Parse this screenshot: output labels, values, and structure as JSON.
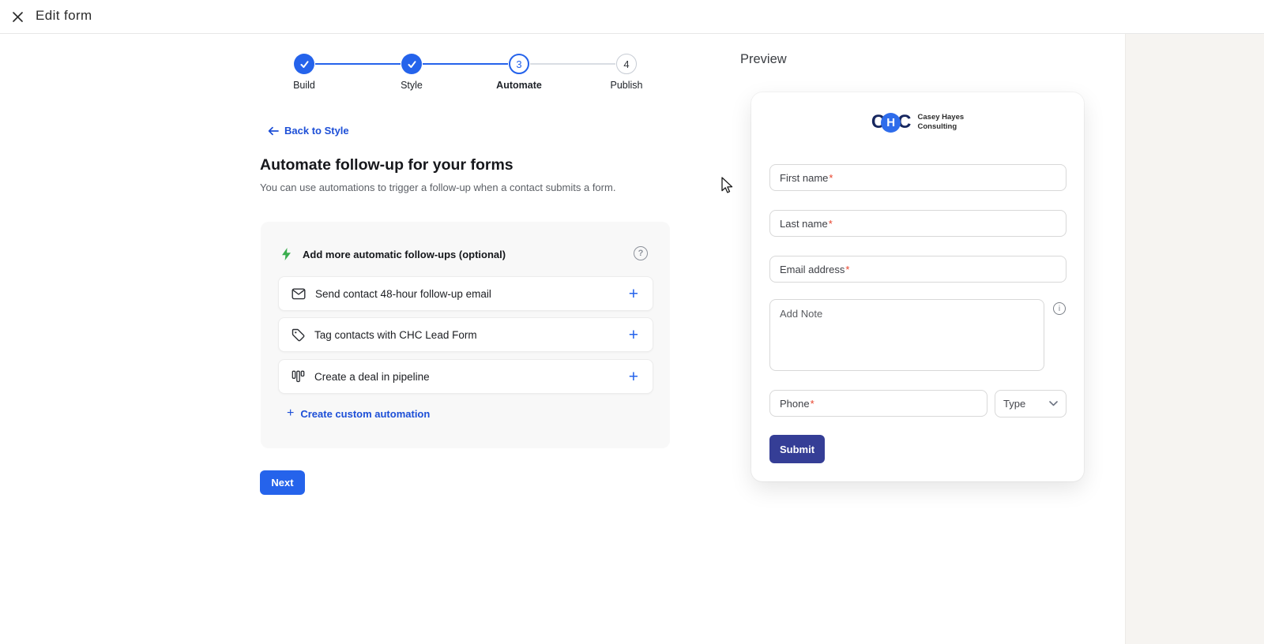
{
  "header": {
    "title": "Edit form"
  },
  "stepper": {
    "steps": [
      {
        "label": "Build",
        "state": "complete"
      },
      {
        "label": "Style",
        "state": "complete"
      },
      {
        "label": "Automate",
        "state": "current",
        "number": "3"
      },
      {
        "label": "Publish",
        "state": "upcoming",
        "number": "4"
      }
    ]
  },
  "main": {
    "back_link": "Back to Style",
    "title": "Automate follow-up for your forms",
    "subtitle": "You can use automations to trigger a follow-up when a contact submits a form.",
    "automations": {
      "header": "Add more automatic follow-ups (optional)",
      "header_icon": "lightning-icon",
      "help_icon": "question-circle-icon",
      "help_glyph": "?",
      "items": [
        {
          "icon": "envelope-icon",
          "label": "Send contact 48-hour follow-up email",
          "action": "+"
        },
        {
          "icon": "tag-icon",
          "label": "Tag contacts with CHC Lead Form",
          "action": "+"
        },
        {
          "icon": "pipeline-icon",
          "label": "Create a deal in pipeline",
          "action": "+"
        }
      ],
      "plus_glyph": "+",
      "custom_link": "Create custom automation"
    },
    "next_label": "Next"
  },
  "preview": {
    "title": "Preview",
    "brand": {
      "logo_letter_left": "C",
      "logo_letter_mid": "H",
      "logo_letter_right": "C",
      "line1": "Casey Hayes",
      "line2": "Consulting"
    },
    "fields": [
      {
        "label": "First name",
        "required": true
      },
      {
        "label": "Last name",
        "required": true
      },
      {
        "label": "Email address",
        "required": true
      }
    ],
    "required_marker": "*",
    "note_placeholder": "Add Note",
    "info_glyph": "i",
    "phone_label": "Phone",
    "type_label": "Type",
    "submit_label": "Submit"
  },
  "colors": {
    "accent_blue": "#2563eb",
    "link_blue": "#1d4fd7",
    "submit_navy": "#353e96",
    "success_green": "#3bae4f",
    "required_red": "#e8432c",
    "card_gray": "#f8f8f8",
    "right_strip": "#f6f4f1"
  }
}
